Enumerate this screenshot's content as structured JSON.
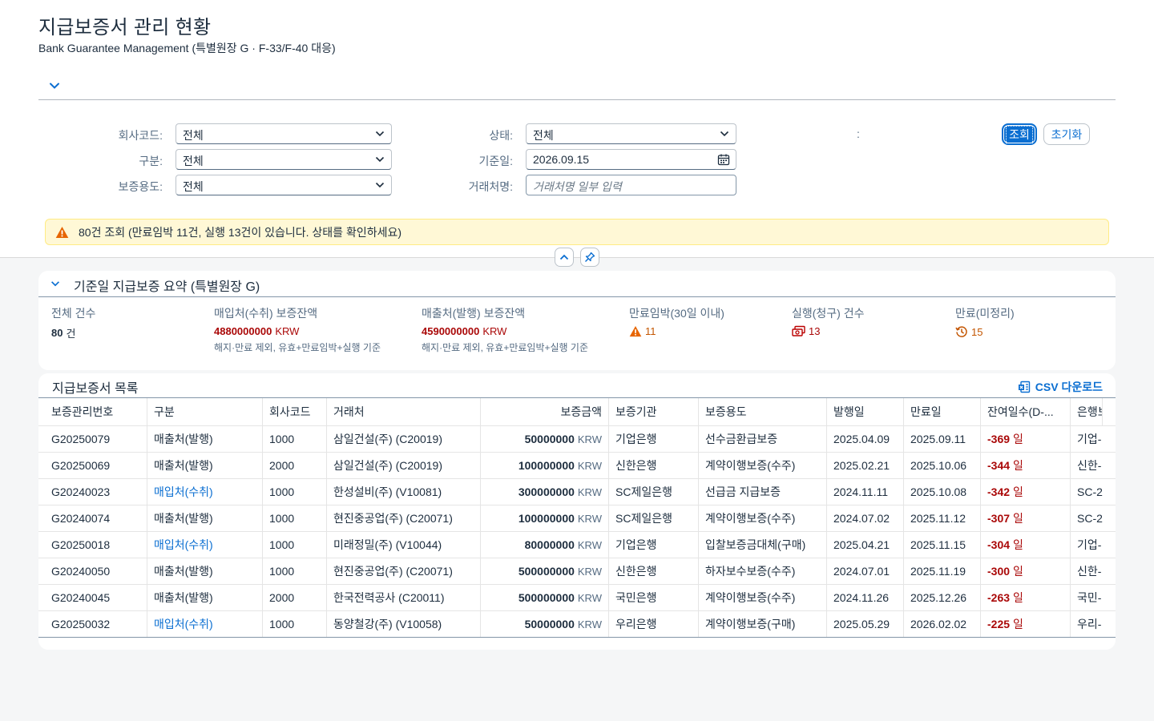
{
  "page": {
    "title": "지급보증서 관리 현황",
    "subtitle": "Bank Guarantee Management (특별원장 G · F-33/F-40 대응)"
  },
  "filters": {
    "company_label": "회사코드:",
    "company_value": "전체",
    "type_label": "구분:",
    "type_value": "전체",
    "purpose_label": "보증용도:",
    "purpose_value": "전체",
    "status_label": "상태:",
    "status_value": "전체",
    "basedate_label": "기준일:",
    "basedate_value": "2026.09.15",
    "partner_label": "거래처명:",
    "partner_placeholder": "거래처명 일부 입력",
    "colon": ":",
    "search_button": "조회",
    "reset_button": "초기화"
  },
  "message": "80건 조회 (만료임박 11건, 실행 13건이 있습니다. 상태를 확인하세요)",
  "summary": {
    "title": "기준일 지급보증 요약 (특별원장 G)",
    "total_label": "전체 건수",
    "total_value": "80",
    "total_unit": "건",
    "purchase_label": "매입처(수취) 보증잔액",
    "purchase_value": "4880000000",
    "purchase_unit": "KRW",
    "purchase_note": "해지·만료 제외, 유효+만료임박+실행 기준",
    "sales_label": "매출처(발행) 보증잔액",
    "sales_value": "4590000000",
    "sales_unit": "KRW",
    "sales_note": "해지·만료 제외, 유효+만료임박+실행 기준",
    "expiring_label": "만료임박(30일 이내)",
    "expiring_value": "11",
    "claimed_label": "실행(청구) 건수",
    "claimed_value": "13",
    "expired_label": "만료(미정리)",
    "expired_value": "15"
  },
  "list": {
    "title": "지급보증서 목록",
    "csv_button": "CSV 다운로드",
    "columns": [
      "보증관리번호",
      "구분",
      "회사코드",
      "거래처",
      "보증금액",
      "보증기관",
      "보증용도",
      "발행일",
      "만료일",
      "잔여일수(D-...",
      "은행보"
    ],
    "rows": [
      {
        "id": "G20250079",
        "type": "매출처(발행)",
        "type_link": false,
        "company": "1000",
        "partner": "삼일건설(주) (C20019)",
        "amount": "50000000",
        "currency": "KRW",
        "bank": "기업은행",
        "purpose": "선수금환급보증",
        "issued": "2025.04.09",
        "expiry": "2025.09.11",
        "days": "-369",
        "days_unit": "일",
        "bank_ref": "기업-"
      },
      {
        "id": "G20250069",
        "type": "매출처(발행)",
        "type_link": false,
        "company": "2000",
        "partner": "삼일건설(주) (C20019)",
        "amount": "100000000",
        "currency": "KRW",
        "bank": "신한은행",
        "purpose": "계약이행보증(수주)",
        "issued": "2025.02.21",
        "expiry": "2025.10.06",
        "days": "-344",
        "days_unit": "일",
        "bank_ref": "신한-"
      },
      {
        "id": "G20240023",
        "type": "매입처(수취)",
        "type_link": true,
        "company": "1000",
        "partner": "한성설비(주) (V10081)",
        "amount": "300000000",
        "currency": "KRW",
        "bank": "SC제일은행",
        "purpose": "선급금 지급보증",
        "issued": "2024.11.11",
        "expiry": "2025.10.08",
        "days": "-342",
        "days_unit": "일",
        "bank_ref": "SC-2"
      },
      {
        "id": "G20240074",
        "type": "매출처(발행)",
        "type_link": false,
        "company": "1000",
        "partner": "현진중공업(주) (C20071)",
        "amount": "100000000",
        "currency": "KRW",
        "bank": "SC제일은행",
        "purpose": "계약이행보증(수주)",
        "issued": "2024.07.02",
        "expiry": "2025.11.12",
        "days": "-307",
        "days_unit": "일",
        "bank_ref": "SC-2"
      },
      {
        "id": "G20250018",
        "type": "매입처(수취)",
        "type_link": true,
        "company": "1000",
        "partner": "미래정밀(주) (V10044)",
        "amount": "80000000",
        "currency": "KRW",
        "bank": "기업은행",
        "purpose": "입찰보증금대체(구매)",
        "issued": "2025.04.21",
        "expiry": "2025.11.15",
        "days": "-304",
        "days_unit": "일",
        "bank_ref": "기업-"
      },
      {
        "id": "G20240050",
        "type": "매출처(발행)",
        "type_link": false,
        "company": "1000",
        "partner": "현진중공업(주) (C20071)",
        "amount": "500000000",
        "currency": "KRW",
        "bank": "신한은행",
        "purpose": "하자보수보증(수주)",
        "issued": "2024.07.01",
        "expiry": "2025.11.19",
        "days": "-300",
        "days_unit": "일",
        "bank_ref": "신한-"
      },
      {
        "id": "G20240045",
        "type": "매출처(발행)",
        "type_link": false,
        "company": "2000",
        "partner": "한국전력공사 (C20011)",
        "amount": "500000000",
        "currency": "KRW",
        "bank": "국민은행",
        "purpose": "계약이행보증(수주)",
        "issued": "2024.11.26",
        "expiry": "2025.12.26",
        "days": "-263",
        "days_unit": "일",
        "bank_ref": "국민-"
      },
      {
        "id": "G20250032",
        "type": "매입처(수취)",
        "type_link": true,
        "company": "1000",
        "partner": "동양철강(주) (V10058)",
        "amount": "50000000",
        "currency": "KRW",
        "bank": "우리은행",
        "purpose": "계약이행보증(구매)",
        "issued": "2025.05.29",
        "expiry": "2026.02.02",
        "days": "-225",
        "days_unit": "일",
        "bank_ref": "우리-"
      }
    ]
  },
  "colors": {
    "accent": "#0a6ed1",
    "negative": "#aa0808",
    "critical": "#c35500",
    "warning_bg": "#fff8d6"
  }
}
